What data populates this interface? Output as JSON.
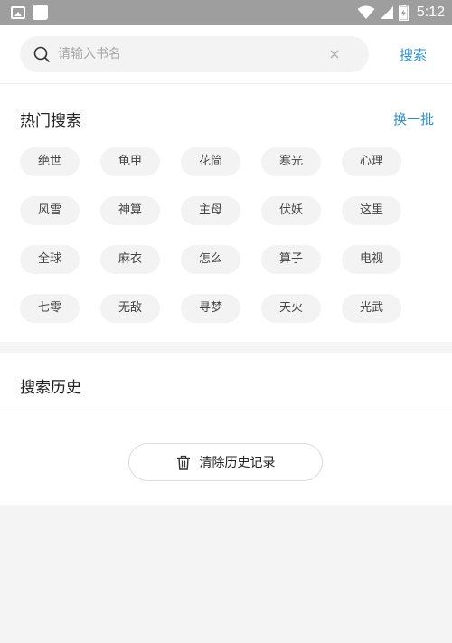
{
  "status_bar": {
    "time": "5:12"
  },
  "search": {
    "placeholder": "请输入书名",
    "button_label": "搜索"
  },
  "hot_search": {
    "title": "热门搜索",
    "refresh_label": "换一批",
    "tags": [
      "绝世",
      "龟甲",
      "花简",
      "寒光",
      "心理",
      "风雪",
      "神算",
      "主母",
      "伏妖",
      "这里",
      "全球",
      "麻衣",
      "怎么",
      "算子",
      "电视",
      "七零",
      "无敌",
      "寻梦",
      "天火",
      "光武"
    ]
  },
  "history": {
    "title": "搜索历史",
    "clear_label": "清除历史记录"
  },
  "colors": {
    "accent": "#2c8fd6",
    "status_bar": "#9e9e9e",
    "tag_bg": "#f3f3f3"
  }
}
